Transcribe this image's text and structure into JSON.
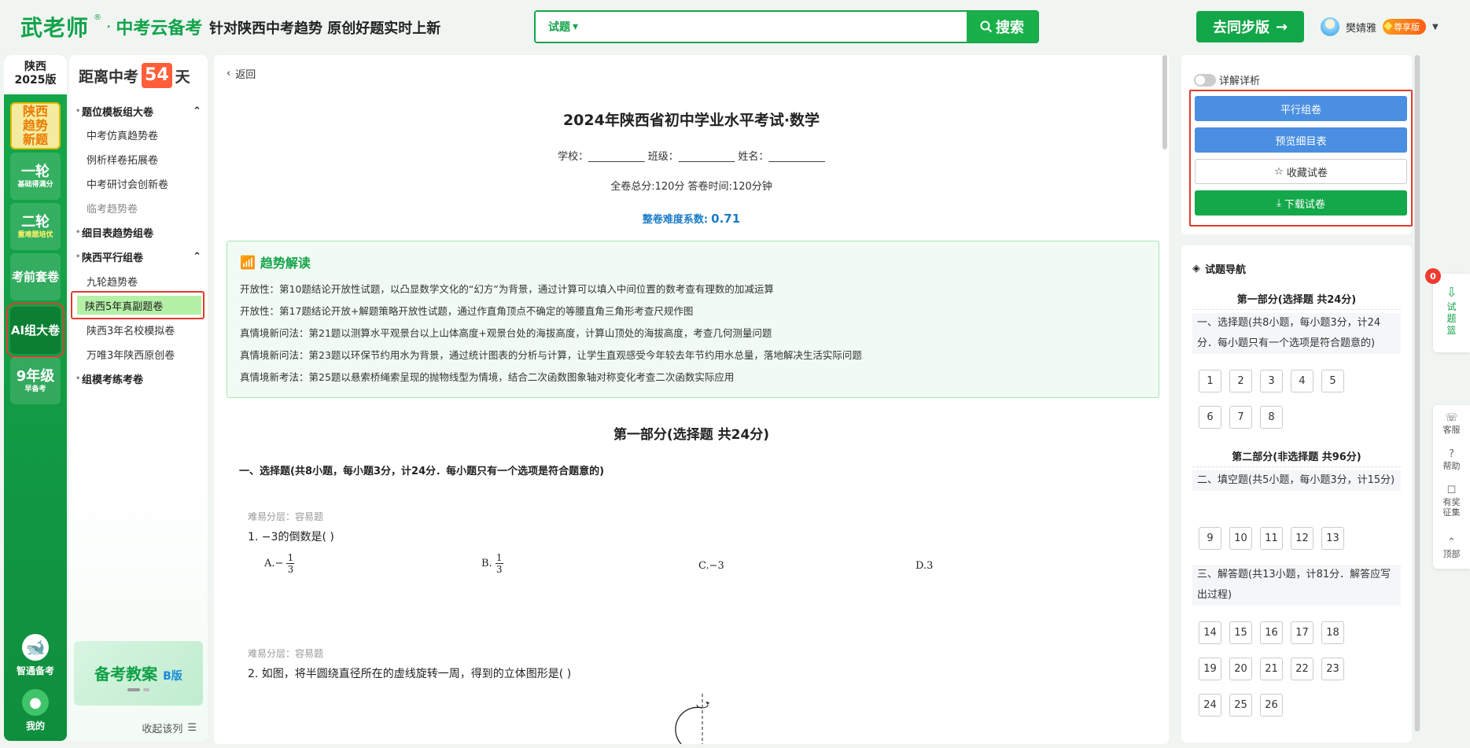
{
  "header": {
    "logo_main": "武老师",
    "logo_reg": "®",
    "logo_sub": "中考云备考",
    "slogan": "针对陕西中考趋势 原创好题实时上新",
    "search_type": "试题",
    "search_placeholder": "",
    "search_button": "搜索",
    "sync_button": "去同步版",
    "user_name": "樊婧雅",
    "vip_badge": "尊享版"
  },
  "left_nav": {
    "version": [
      "陕西",
      "2025版"
    ],
    "tiles": [
      {
        "big": "陕西趋势新题",
        "small": ""
      },
      {
        "big": "一轮",
        "small": "基础得满分"
      },
      {
        "big": "二轮",
        "small": "重难题培优"
      },
      {
        "big": "考前套卷",
        "small": ""
      },
      {
        "big": "AI组大卷",
        "small": ""
      },
      {
        "big": "9年级",
        "small": "早备考"
      }
    ],
    "zhitong": "智通备考",
    "mine": "我的"
  },
  "cat_nav": {
    "countdown_prefix": "距离中考",
    "countdown_days": "54",
    "countdown_suffix": "天",
    "groups": [
      {
        "label": "题位模板组大卷",
        "expanded": true
      },
      {
        "label": "细目表趋势组卷",
        "expanded": false
      },
      {
        "label": "陕西平行组卷",
        "expanded": true
      },
      {
        "label": "组模考练考卷",
        "expanded": false
      }
    ],
    "items_group1": [
      "中考仿真趋势卷",
      "例析样卷拓展卷",
      "中考研讨会创新卷",
      "临考趋势卷"
    ],
    "items_group3": [
      "九轮趋势卷",
      "陕西5年真副题卷",
      "陕西3年名校模拟卷",
      "万唯3年陕西原创卷"
    ],
    "promo_title": "备考教案",
    "promo_edition": "B版",
    "collapse": "收起该列"
  },
  "main": {
    "back": "返回",
    "paper_title": "2024年陕西省初中学业水平考试·数学",
    "info_line": "学校：___________ 班级：___________ 姓名：___________",
    "score_line": "全卷总分:120分    答卷时间:120分钟",
    "difficulty_label": "整卷难度系数:",
    "difficulty_value": "0.71",
    "trend_title": "趋势解读",
    "trend_lines": [
      "开放性：第10题结论开放性试题，以凸显数学文化的“幻方”为背景，通过计算可以填入中间位置的数考查有理数的加减运算",
      "开放性：第17题结论开放+解题策略开放性试题，通过作直角顶点不确定的等腰直角三角形考查尺规作图",
      "真情境新问法：第21题以测算水平观景台以上山体高度+观景台处的海拔高度，计算山顶处的海拔高度，考查几何测量问题",
      "真情境新问法：第23题以环保节约用水为背景，通过统计图表的分析与计算，让学生直观感受今年较去年节约用水总量，落地解决生活实际问题",
      "真情境新考法：第25题以悬索桥绳索呈现的抛物线型为情境，结合二次函数图象轴对称变化考查二次函数实际应用"
    ],
    "section_title": "第一部分(选择题    共24分)",
    "q_head": "一、选择题(共8小题，每小题3分，计24分．每小题只有一个选项是符合题意的)",
    "q1_diff": "难易分层：容易题",
    "q1_text": "1.  −3的倒数是(        )",
    "q1_opt_a": "A.−",
    "q1_opt_b": "B.",
    "q1_opt_c": "C.−3",
    "q1_opt_d": "D.3",
    "frac_num": "1",
    "frac_den": "3",
    "q2_diff": "难易分层：容易题",
    "q2_text": "2.  如图，将半圆绕直径所在的虚线旋转一周，得到的立体图形是(        )"
  },
  "right_panel": {
    "toggle_label": "详解详析",
    "btn_parallel": "平行组卷",
    "btn_preview": "预览细目表",
    "btn_favorite": "收藏试卷",
    "btn_download": "下载试卷",
    "nav_title": "试题导航",
    "part1_title": "第一部分(选择题    共24分)",
    "part1_desc": "一、选择题(共8小题，每小题3分，计24分．每小题只有一个选项是符合题意的)",
    "part1_nums": [
      "1",
      "2",
      "3",
      "4",
      "5",
      "6",
      "7",
      "8"
    ],
    "part2_title": "第二部分(非选择题    共96分)",
    "part2_desc1": "二、填空题(共5小题，每小题3分，计15分)",
    "part2_nums1": [
      "9",
      "10",
      "11",
      "12",
      "13"
    ],
    "part2_desc2": "三、解答题(共13小题，计81分．解答应写出过程)",
    "part2_nums2": [
      "14",
      "15",
      "16",
      "17",
      "18",
      "19",
      "20",
      "21",
      "22",
      "23",
      "24",
      "25",
      "26"
    ]
  },
  "floating": {
    "basket_count": "0",
    "basket_label": "试题篮",
    "tools": [
      "客服",
      "帮助",
      "有奖征集",
      "顶部"
    ]
  }
}
